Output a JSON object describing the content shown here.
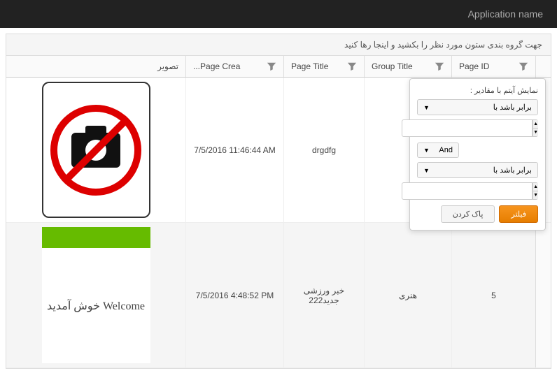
{
  "navbar": {
    "title": "Application name"
  },
  "group_panel": "جهت گروه بندی ستون مورد نظر را بکشید و اینجا رها کنید",
  "columns": {
    "page_id": "Page ID",
    "group_title": "Group Title",
    "page_title": "Page Title",
    "page_created": "Page Crea...",
    "image": "تصویر"
  },
  "rows": [
    {
      "page_id": "",
      "group_title": "",
      "page_title": "drgdfg",
      "date": "7/5/2016 11:46:44 AM",
      "image_kind": "no-photo"
    },
    {
      "page_id": "5",
      "group_title": "هنری",
      "page_title": "خبر ورزشی جدید222",
      "date": "7/5/2016 4:48:52 PM",
      "image_kind": "welcome",
      "image_text": "Welcome خوش آمدید"
    }
  ],
  "filter_popup": {
    "header": "نمایش آیتم با مقادیر :",
    "operator1": "برابر باشد با",
    "logic": "And",
    "operator2": "برابر باشد با",
    "btn_filter": "فیلتر",
    "btn_clear": "پاک کردن"
  }
}
